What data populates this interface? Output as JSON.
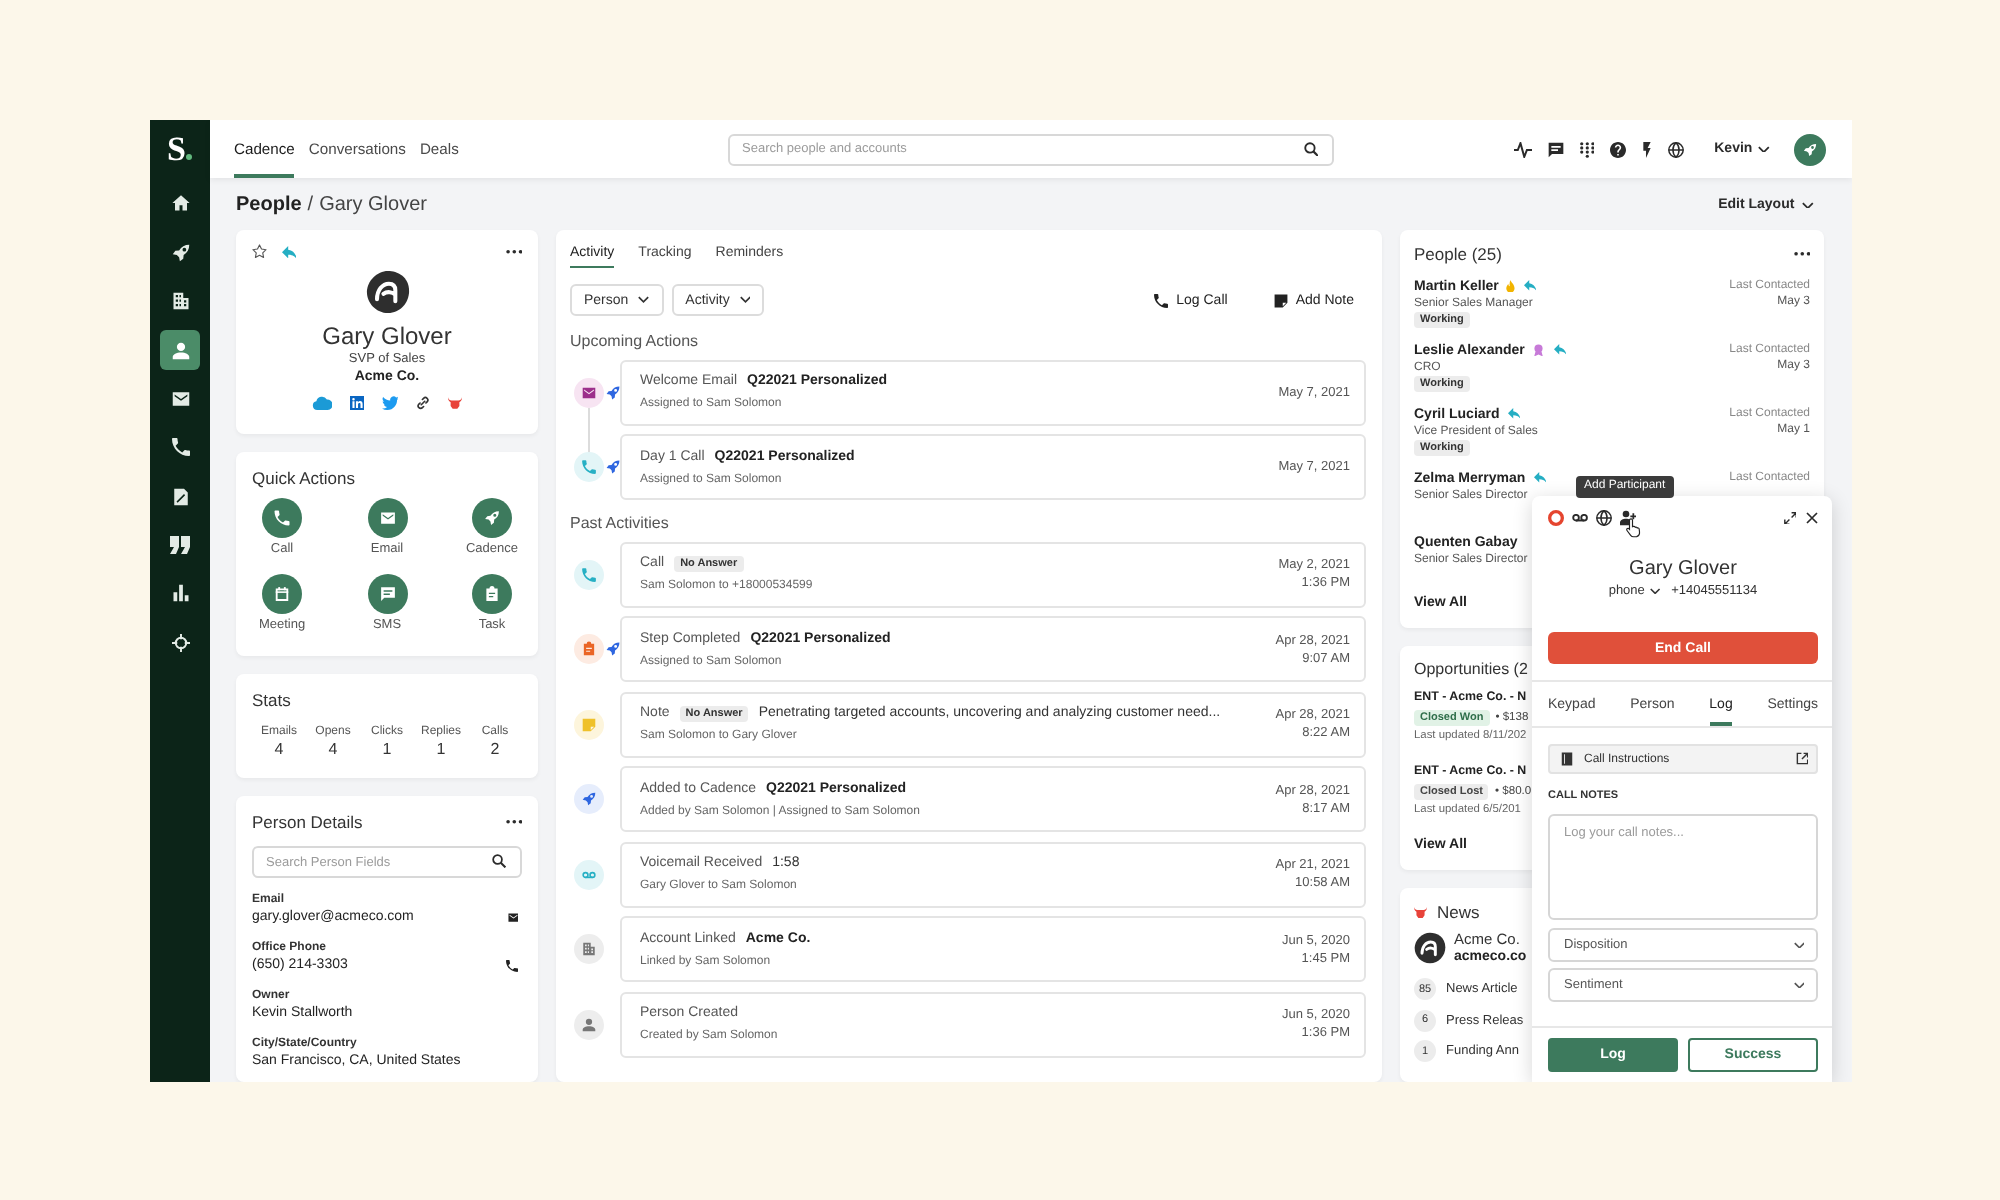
{
  "sidebar": {
    "logo": "S",
    "items": [
      {
        "kind": "home",
        "selected": false
      },
      {
        "kind": "rocket",
        "selected": false
      },
      {
        "kind": "building",
        "selected": false
      },
      {
        "kind": "person",
        "selected": true
      },
      {
        "kind": "envelope",
        "selected": false
      },
      {
        "kind": "phone",
        "selected": false
      },
      {
        "kind": "document",
        "selected": false
      },
      {
        "kind": "quote",
        "selected": false
      },
      {
        "kind": "bar-chart",
        "selected": false
      },
      {
        "kind": "crosshair",
        "selected": false
      }
    ]
  },
  "top_nav": {
    "tabs": [
      {
        "label": "Cadence",
        "selected": true
      },
      {
        "label": "Conversations",
        "selected": false
      },
      {
        "label": "Deals",
        "selected": false
      }
    ],
    "search": {
      "placeholder": "Search people and accounts"
    },
    "user": "Kevin"
  },
  "breadcrumb": {
    "parent": "People",
    "separator": "/",
    "current": "Gary Glover"
  },
  "edit_layout": "Edit Layout",
  "profile": {
    "starred": false,
    "name": "Gary Glover",
    "title": "SVP of Sales",
    "company": "Acme Co."
  },
  "quick_actions": {
    "title": "Quick Actions",
    "items": [
      {
        "kind": "phone",
        "label": "Call"
      },
      {
        "kind": "envelope",
        "label": "Email"
      },
      {
        "kind": "rocket",
        "label": "Cadence"
      },
      {
        "kind": "calendar",
        "label": "Meeting"
      },
      {
        "kind": "chat",
        "label": "SMS"
      },
      {
        "kind": "clipboard",
        "label": "Task"
      }
    ]
  },
  "stats": {
    "title": "Stats",
    "items": [
      {
        "label": "Emails",
        "value": "4"
      },
      {
        "label": "Opens",
        "value": "4"
      },
      {
        "label": "Clicks",
        "value": "1"
      },
      {
        "label": "Replies",
        "value": "1"
      },
      {
        "label": "Calls",
        "value": "2"
      }
    ]
  },
  "person_details": {
    "title": "Person Details",
    "search": {
      "placeholder": "Search Person Fields"
    },
    "fields": [
      {
        "label": "Email",
        "value": "gary.glover@acmeco.com",
        "kind": "email"
      },
      {
        "label": "Office Phone",
        "value": "(650) 214-3303",
        "kind": "phone"
      },
      {
        "label": "Owner",
        "value": "Kevin Stallworth",
        "kind": "text"
      },
      {
        "label": "City/State/Country",
        "value": "San Francisco, CA, United States",
        "kind": "text"
      }
    ]
  },
  "activity": {
    "tabs": [
      {
        "label": "Activity",
        "selected": true
      },
      {
        "label": "Tracking",
        "selected": false
      },
      {
        "label": "Reminders",
        "selected": false
      }
    ],
    "filters": [
      {
        "label": "Person"
      },
      {
        "label": "Activity"
      }
    ],
    "actions": [
      {
        "kind": "phone",
        "label": "Log Call"
      },
      {
        "kind": "note",
        "label": "Add Note"
      }
    ],
    "sections": [
      {
        "title": "Upcoming Actions",
        "connected": true,
        "items": [
          {
            "kind": "email",
            "cadence": true,
            "title": "Welcome Email",
            "detail": "Q22021 Personalized",
            "detail_bold": true,
            "subtitle": "Assigned to Sam Solomon",
            "date": "May 7, 2021"
          },
          {
            "kind": "call",
            "cadence": true,
            "title": "Day 1 Call",
            "detail": "Q22021 Personalized",
            "detail_bold": true,
            "subtitle": "Assigned to Sam Solomon",
            "date": "May 7, 2021"
          }
        ]
      },
      {
        "title": "Past Activities",
        "connected": false,
        "items": [
          {
            "kind": "call",
            "cadence": false,
            "title": "Call",
            "badge": "No Answer",
            "subtitle": "Sam Solomon to +18000534599",
            "date": "May 2, 2021",
            "time": "1:36 PM"
          },
          {
            "kind": "step",
            "cadence": true,
            "title": "Step Completed",
            "detail": "Q22021 Personalized",
            "detail_bold": true,
            "subtitle": "Assigned to Sam Solomon",
            "date": "Apr 28, 2021",
            "time": "9:07 AM"
          },
          {
            "kind": "note",
            "cadence": false,
            "title": "Note",
            "badge": "No Answer",
            "detail": "Penetrating targeted accounts, uncovering and analyzing customer need...",
            "detail_bold": false,
            "subtitle": "Sam Solomon to Gary Glover",
            "date": "Apr 28, 2021",
            "time": "8:22 AM"
          },
          {
            "kind": "cadence",
            "cadence": false,
            "title": "Added to Cadence",
            "detail": "Q22021 Personalized",
            "detail_bold": true,
            "subtitle": "Added by Sam Solomon | Assigned to Sam Solomon",
            "date": "Apr 28, 2021",
            "time": "8:17 AM"
          },
          {
            "kind": "voicemail",
            "cadence": false,
            "title": "Voicemail Received",
            "detail": "1:58",
            "detail_bold": false,
            "subtitle": "Gary Glover to Sam Solomon",
            "date": "Apr 21, 2021",
            "time": "10:58 AM"
          },
          {
            "kind": "account",
            "cadence": false,
            "title": "Account Linked",
            "detail": "Acme Co.",
            "detail_bold": true,
            "subtitle": "Linked by Sam Solomon",
            "date": "Jun 5, 2020",
            "time": "1:45 PM"
          },
          {
            "kind": "person",
            "cadence": false,
            "title": "Person Created",
            "subtitle": "Created by Sam Solomon",
            "date": "Jun 5, 2020",
            "time": "1:36 PM"
          }
        ]
      }
    ]
  },
  "people": {
    "title": "People (25)",
    "items": [
      {
        "kind": "flame",
        "name": "Martin Keller",
        "replied": true,
        "role": "Senior Sales Manager",
        "status": "Working",
        "contacted_label": "Last Contacted",
        "contacted": "May 3"
      },
      {
        "kind": "award",
        "name": "Leslie Alexander",
        "replied": true,
        "role": "CRO",
        "status": "Working",
        "contacted_label": "Last Contacted",
        "contacted": "May 3"
      },
      {
        "kind": "plain",
        "name": "Cyril Luciard",
        "replied": true,
        "role": "Vice President of Sales",
        "status": "Working",
        "contacted_label": "Last Contacted",
        "contacted": "May 1"
      },
      {
        "kind": "plain",
        "name": "Zelma Merryman",
        "replied": true,
        "role": "Senior Sales Director",
        "contacted_label": "Last Contacted"
      },
      {
        "kind": "plain",
        "name": "Quenten Gabay",
        "replied": false,
        "role": "Senior Sales Director"
      }
    ],
    "view_all": "View All"
  },
  "opportunities": {
    "title": "Opportunities (2",
    "items": [
      {
        "name": "ENT - Acme Co. - N",
        "stage": "Closed Won",
        "won": true,
        "amount": "• $138",
        "updated": "Last updated 8/11/202"
      },
      {
        "name": "ENT - Acme Co. - N",
        "stage": "Closed Lost",
        "won": false,
        "amount": "• $80.0",
        "updated": "Last updated 6/5/201"
      }
    ],
    "view_all": "View All"
  },
  "news": {
    "title": "News",
    "company": "Acme Co.",
    "domain": "acmeco.co",
    "items": [
      {
        "count": "85",
        "label": "News Article"
      },
      {
        "count": "6",
        "label": "Press Releas"
      },
      {
        "count": "1",
        "label": "Funding Ann"
      }
    ]
  },
  "call_panel": {
    "tooltip": "Add Participant",
    "name": "Gary Glover",
    "line": "phone",
    "number": "+14045551134",
    "end_call": "End Call",
    "tabs": [
      {
        "label": "Keypad",
        "selected": false
      },
      {
        "label": "Person",
        "selected": false
      },
      {
        "label": "Log",
        "selected": true
      },
      {
        "label": "Settings",
        "selected": false
      }
    ],
    "instructions": "Call Instructions",
    "notes_label": "CALL NOTES",
    "notes": {
      "placeholder": "Log your call notes..."
    },
    "selects": [
      {
        "placeholder": "Disposition"
      },
      {
        "placeholder": "Sentiment"
      }
    ],
    "buttons": [
      {
        "kind": "primary",
        "label": "Log"
      },
      {
        "kind": "outline",
        "label": "Success"
      }
    ]
  }
}
